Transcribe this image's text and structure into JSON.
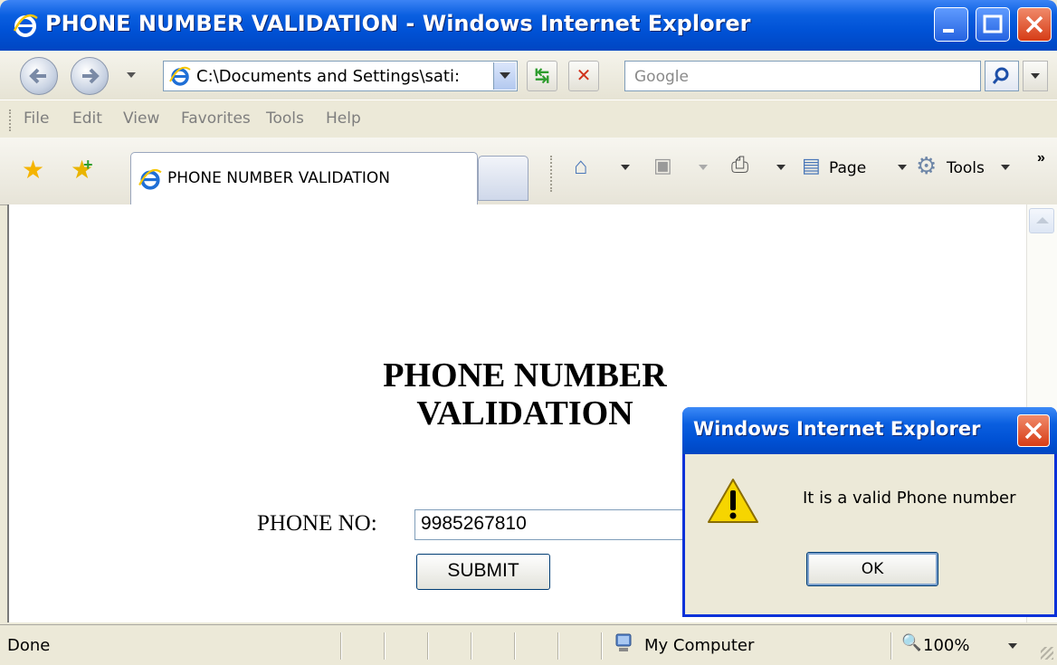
{
  "window": {
    "title": "PHONE NUMBER VALIDATION - Windows Internet Explorer"
  },
  "address_bar": {
    "url": "C:\\Documents and Settings\\sati:"
  },
  "search": {
    "placeholder": "Google"
  },
  "menu": {
    "items": [
      "File",
      "Edit",
      "View",
      "Favorites",
      "Tools",
      "Help"
    ]
  },
  "tabs": {
    "active_label": "PHONE NUMBER VALIDATION"
  },
  "command_bar": {
    "page_label": "Page",
    "tools_label": "Tools",
    "chevron": "»"
  },
  "page": {
    "heading": "PHONE NUMBER VALIDATION",
    "phone_label": "PHONE NO:",
    "phone_value": "9985267810",
    "submit_label": "SUBMIT"
  },
  "status_bar": {
    "status_text": "Done",
    "zone": "My Computer",
    "zoom": "100%"
  },
  "dialog": {
    "title": "Windows Internet Explorer",
    "message": "It is a valid Phone number",
    "ok_label": "OK"
  },
  "colors": {
    "title_bar": "#0052d6",
    "window_bg": "#ece9d8",
    "close_button": "#d63c16"
  }
}
